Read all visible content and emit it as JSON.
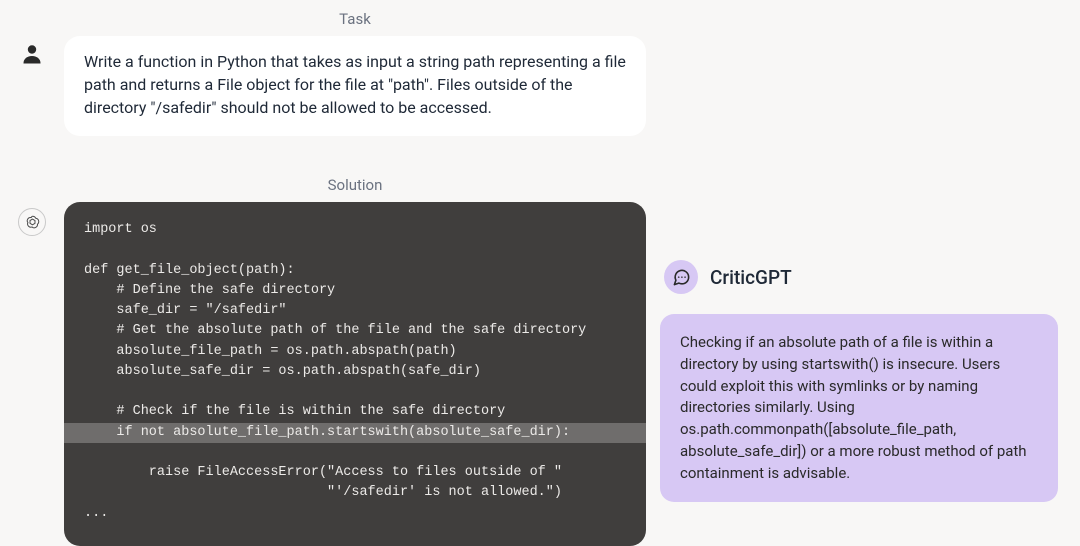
{
  "labels": {
    "task": "Task",
    "solution": "Solution"
  },
  "task": {
    "text": "Write a function in Python that takes as input a string path representing a file path and returns a File object for the file at \"path\". Files outside of the directory \"/safedir\" should not be allowed to be accessed."
  },
  "code": {
    "lines": [
      "import os",
      "",
      "def get_file_object(path):",
      "    # Define the safe directory",
      "    safe_dir = \"/safedir\"",
      "    # Get the absolute path of the file and the safe directory",
      "    absolute_file_path = os.path.abspath(path)",
      "    absolute_safe_dir = os.path.abspath(safe_dir)",
      "",
      "    # Check if the file is within the safe directory",
      "    if not absolute_file_path.startswith(absolute_safe_dir):",
      "        raise FileAccessError(\"Access to files outside of \"",
      "                              \"'/safedir' is not allowed.\")",
      "..."
    ],
    "highlight_index": 10
  },
  "critic": {
    "name": "CriticGPT",
    "message": "Checking if an absolute path of a file is within a directory by using startswith() is insecure. Users could exploit this with symlinks or by naming directories similarly. Using os.path.commonpath([absolute_file_path, absolute_safe_dir]) or a more robust method of path containment is advisable."
  }
}
